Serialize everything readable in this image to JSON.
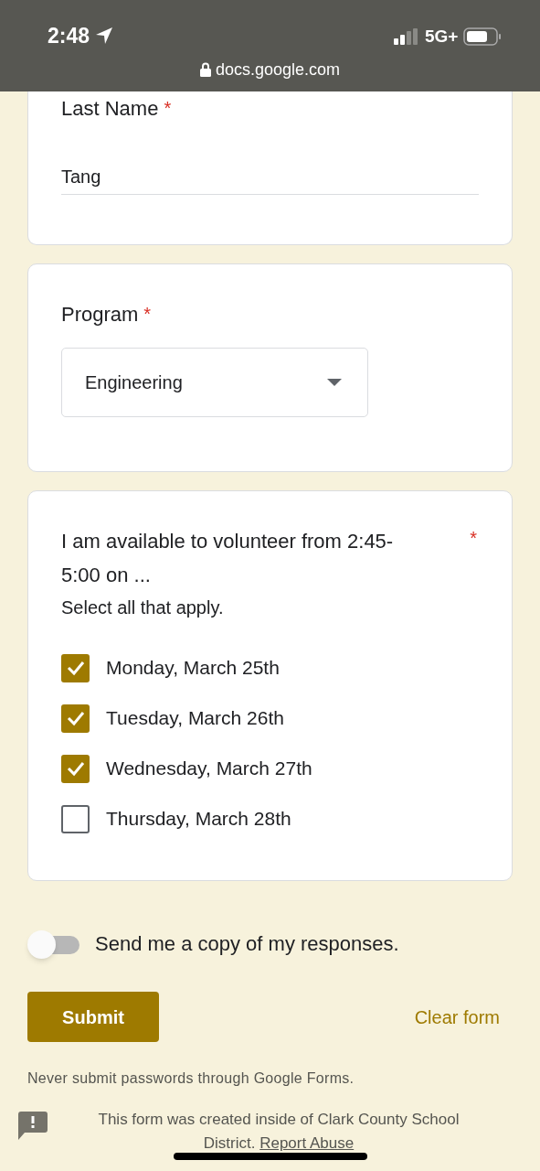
{
  "status_bar": {
    "time": "2:48",
    "network": "5G+"
  },
  "address_bar": {
    "url": "docs.google.com"
  },
  "questions": [
    {
      "kind": "text",
      "label": "Last Name",
      "required_mark": "*",
      "value": "Tang"
    },
    {
      "kind": "dropdown",
      "label": "Program",
      "required_mark": "*",
      "value": "Engineering"
    },
    {
      "kind": "checkboxes",
      "label": "I am available to volunteer from 2:45-5:00 on ...",
      "required_mark": "*",
      "hint": "Select all that apply.",
      "options": [
        {
          "label": "Monday, March 25th",
          "checked": true
        },
        {
          "label": "Tuesday, March 26th",
          "checked": true
        },
        {
          "label": "Wednesday, March 27th",
          "checked": true
        },
        {
          "label": "Thursday, March 28th",
          "checked": false
        }
      ]
    }
  ],
  "copy_toggle": {
    "label": "Send me a copy of my responses.",
    "on": false
  },
  "buttons": {
    "submit": "Submit",
    "clear": "Clear form"
  },
  "footer": {
    "warning": "Never submit passwords through Google Forms.",
    "notice": "This form was created inside of Clark County School District.",
    "report_link": "Report Abuse"
  }
}
